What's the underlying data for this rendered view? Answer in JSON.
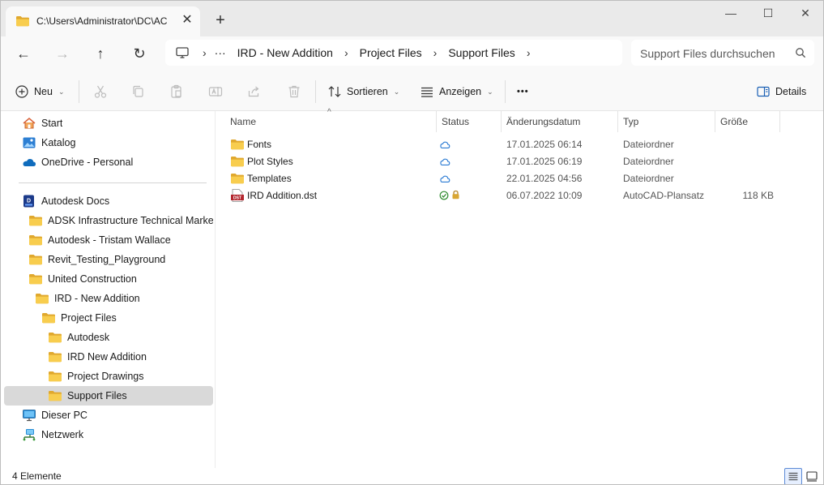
{
  "window": {
    "tab_title": "C:\\Users\\Administrator\\DC\\AC",
    "tab_close": "✕",
    "new_tab": "+",
    "minimize": "—",
    "maximize": "☐",
    "close": "✕"
  },
  "nav": {
    "back": "←",
    "forward": "→",
    "up": "↑",
    "refresh": "↻",
    "overflow": "···",
    "breadcrumbs": [
      "IRD - New Addition",
      "Project Files",
      "Support Files"
    ],
    "separator": "›"
  },
  "search": {
    "placeholder": "Support Files durchsuchen"
  },
  "toolbar": {
    "new_label": "Neu",
    "sort_label": "Sortieren",
    "view_label": "Anzeigen",
    "more_label": "•••",
    "details_label": "Details",
    "chevron": "⌄"
  },
  "sidebar": {
    "items": [
      {
        "label": "Start",
        "icon": "home-icon"
      },
      {
        "label": "Katalog",
        "icon": "gallery-icon"
      },
      {
        "label": "OneDrive - Personal",
        "icon": "cloud-icon"
      },
      {
        "label": "Autodesk Docs",
        "icon": "autodesk-docs-icon"
      },
      {
        "label": "ADSK Infrastructure Technical Marketing",
        "icon": "folder-icon"
      },
      {
        "label": "Autodesk - Tristam Wallace",
        "icon": "folder-icon"
      },
      {
        "label": "Revit_Testing_Playground",
        "icon": "folder-icon"
      },
      {
        "label": "United Construction",
        "icon": "folder-icon"
      },
      {
        "label": "IRD - New Addition",
        "icon": "folder-icon"
      },
      {
        "label": "Project Files",
        "icon": "folder-icon"
      },
      {
        "label": "Autodesk",
        "icon": "folder-icon"
      },
      {
        "label": "IRD New Addition",
        "icon": "folder-icon"
      },
      {
        "label": "Project Drawings",
        "icon": "folder-icon"
      },
      {
        "label": "Support Files",
        "icon": "folder-icon"
      },
      {
        "label": "Dieser PC",
        "icon": "pc-icon"
      },
      {
        "label": "Netzwerk",
        "icon": "network-icon"
      }
    ]
  },
  "columns": {
    "name": "Name",
    "status": "Status",
    "date": "Änderungsdatum",
    "type": "Typ",
    "size": "Größe",
    "sort_caret": "^"
  },
  "files": [
    {
      "name": "Fonts",
      "date": "17.01.2025 06:14",
      "type": "Dateiordner",
      "size": "",
      "status": "cloud"
    },
    {
      "name": "Plot Styles",
      "date": "17.01.2025 06:19",
      "type": "Dateiordner",
      "size": "",
      "status": "cloud"
    },
    {
      "name": "Templates",
      "date": "22.01.2025 04:56",
      "type": "Dateiordner",
      "size": "",
      "status": "cloud"
    },
    {
      "name": "IRD Addition.dst",
      "date": "06.07.2022 10:09",
      "type": "AutoCAD-Plansatz",
      "size": "118 KB",
      "status": "synced-locked"
    }
  ],
  "dst_icon_text": "DST",
  "statusbar": {
    "count": "4 Elemente"
  },
  "colors": {
    "folder": "#f5c542",
    "folder_dark": "#e0a82e",
    "accent": "#0067c0",
    "cloud_blue": "#2b7bd3"
  }
}
